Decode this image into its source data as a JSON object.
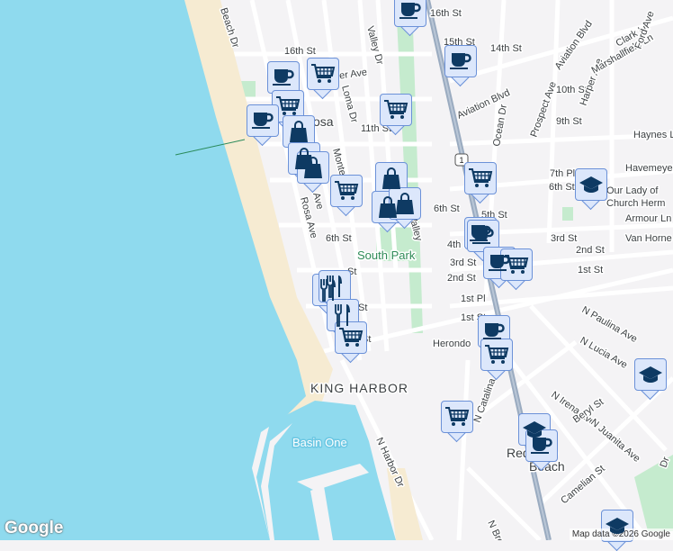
{
  "map": {
    "colors": {
      "water": "#8fdaee",
      "land": "#f4f3f5",
      "beach": "#f6ebd2",
      "park": "#c5ebce",
      "highway": "#9aabc0",
      "marker_fill": "#dce7fb",
      "marker_border": "#6b91d8",
      "marker_icon": "#0e3a63"
    },
    "places": {
      "hermosa": "osa",
      "south_park": "South Park",
      "king_harbor": "KING HARBOR",
      "basin_one": "Basin One",
      "redondo": "Redondo",
      "beach": "Beach",
      "our_lady": "Our Lady of",
      "church": "Church Herm"
    },
    "streets": [
      "Beach Dr",
      "16th St",
      "Pier Ave",
      "Loma Dr",
      "11th St",
      "Valley Dr",
      "Monte",
      "Rosa Ave",
      "6th St",
      "Ave",
      "Valley",
      "6th St",
      "5th St",
      "4th St",
      "3rd St",
      "2nd St",
      "1st Pl",
      "1st St",
      "Herondo",
      "N Catalina",
      "N Harbor Dr",
      "15th St",
      "14th St",
      "16th St",
      "Aviation Blvd",
      "Aviation Blvd",
      "10th St",
      "9th St",
      "Ocean Dr",
      "Prospect Ave",
      "Harper Ave",
      "Marshallfield Ln",
      "Clark Ln",
      "Ford Ave",
      "Haynes Ln",
      "7th Pl",
      "6th St",
      "Havemeyer Ln",
      "Armour Ln",
      "Van Horne Ln",
      "3rd St",
      "2nd St",
      "1st St",
      "N Paulina Ave",
      "N Lucia Ave",
      "N Irena Ave",
      "N Juanita Ave",
      "Beryl St",
      "Camelian St",
      "N Broa",
      "St",
      "St",
      "St",
      "Dr"
    ],
    "highway_shield": "1",
    "markers": [
      "coffee",
      "coffee",
      "cart",
      "cart",
      "coffee",
      "cart",
      "bag",
      "bag",
      "bag",
      "cart",
      "bag",
      "bag",
      "bag",
      "coffee",
      "cart",
      "coffee",
      "coffee",
      "coffee",
      "cart",
      "restaurant",
      "restaurant",
      "restaurant",
      "cart",
      "coffee",
      "cart",
      "cart",
      "school",
      "school",
      "school",
      "school",
      "coffee"
    ]
  },
  "footer": {
    "logo": "Google",
    "attribution": "Map data ©2026 Google"
  }
}
